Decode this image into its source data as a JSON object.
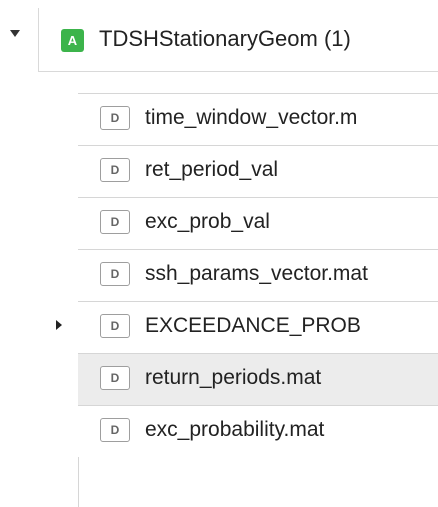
{
  "group": {
    "badge": "A",
    "title": "TDSHStationaryGeom (1)"
  },
  "items": [
    {
      "badge": "D",
      "label": "time_window_vector.m"
    },
    {
      "badge": "D",
      "label": "ret_period_val"
    },
    {
      "badge": "D",
      "label": "exc_prob_val"
    },
    {
      "badge": "D",
      "label": "ssh_params_vector.mat"
    },
    {
      "badge": "D",
      "label": "EXCEEDANCE_PROB"
    },
    {
      "badge": "D",
      "label": "return_periods.mat"
    },
    {
      "badge": "D",
      "label": "exc_probability.mat"
    }
  ],
  "colors": {
    "group_badge": "#3cb44b",
    "selected_row": "#ececec"
  },
  "icons": {
    "expand": "caret-down-icon",
    "collapsed": "caret-right-icon"
  }
}
